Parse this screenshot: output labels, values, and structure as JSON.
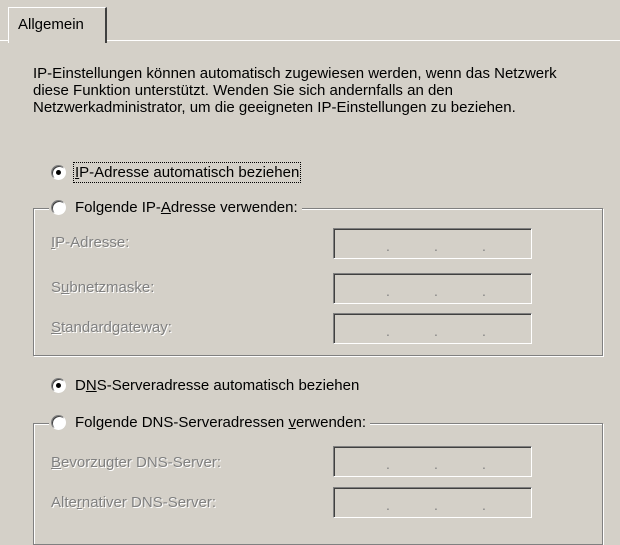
{
  "tab": {
    "label": "Allgemein"
  },
  "intro_text": "IP-Einstellungen können automatisch zugewiesen werden, wenn das Netzwerk diese Funktion unterstützt. Wenden Sie sich andernfalls an den Netzwerkadministrator, um die geeigneten IP-Einstellungen zu beziehen.",
  "ip_options": {
    "auto": {
      "pre": "",
      "u": "I",
      "post": "P-Adresse automatisch beziehen",
      "checked": true
    },
    "manual": {
      "pre": "Folgende IP-",
      "u": "A",
      "post": "dresse verwenden:",
      "checked": false
    }
  },
  "ip_fields": [
    {
      "pre": "",
      "u": "I",
      "post": "P-Adresse:",
      "value": ". . ."
    },
    {
      "pre": "S",
      "u": "u",
      "post": "bnetzmaske:",
      "value": ". . ."
    },
    {
      "pre": "",
      "u": "S",
      "post": "tandardgateway:",
      "value": ". . ."
    }
  ],
  "dns_options": {
    "auto": {
      "pre": "D",
      "u": "N",
      "post": "S-Serveradresse automatisch beziehen",
      "checked": true
    },
    "manual": {
      "pre": "Folgende DNS-Serveradressen ",
      "u": "v",
      "post": "erwenden:",
      "checked": false
    }
  },
  "dns_fields": [
    {
      "pre": "",
      "u": "B",
      "post": "evorzugter DNS-Server:",
      "value": ". . ."
    },
    {
      "pre": "Alte",
      "u": "r",
      "post": "nativer DNS-Server:",
      "value": ". . ."
    }
  ],
  "colors": {
    "face": "#d4d0c8",
    "shadow": "#808080",
    "highlight": "#ffffff",
    "disabled_text": "#808080"
  }
}
